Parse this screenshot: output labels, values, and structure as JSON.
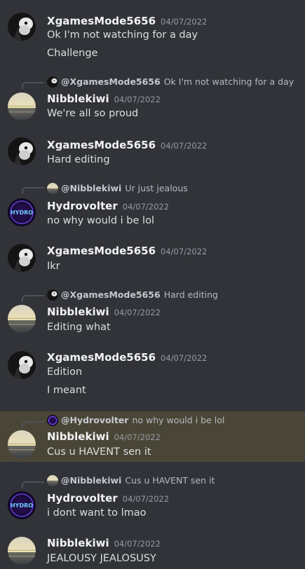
{
  "users": {
    "xgames": "XgamesMode5656",
    "nibble": "Nibblekiwi",
    "hydro": "Hydrovolter"
  },
  "messages": [
    {
      "author": "XgamesMode5656",
      "time": "04/07/2022",
      "lines": [
        "Ok I'm not watching for a day",
        "Challenge"
      ]
    },
    {
      "reply_to": "@XgamesMode5656",
      "reply_text": "Ok I'm not watching for a day",
      "author": "Nibblekiwi",
      "time": "04/07/2022",
      "lines": [
        "We're all so proud"
      ]
    },
    {
      "author": "XgamesMode5656",
      "time": "04/07/2022",
      "lines": [
        "Hard editing"
      ]
    },
    {
      "reply_to": "@Nibblekiwi",
      "reply_text": "Ur just jealous",
      "author": "Hydrovolter",
      "time": "04/07/2022",
      "lines": [
        "no why would i be lol"
      ]
    },
    {
      "author": "XgamesMode5656",
      "time": "04/07/2022",
      "lines": [
        "Ikr"
      ]
    },
    {
      "reply_to": "@XgamesMode5656",
      "reply_text": "Hard editing",
      "author": "Nibblekiwi",
      "time": "04/07/2022",
      "lines": [
        "Editing what"
      ]
    },
    {
      "author": "XgamesMode5656",
      "time": "04/07/2022",
      "lines": [
        "Edition",
        "I meant"
      ]
    },
    {
      "reply_to": "@Hydrovolter",
      "reply_text": "no why would i be lol",
      "author": "Nibblekiwi",
      "time": "04/07/2022",
      "lines": [
        "Cus u HAVENT sen it"
      ],
      "highlighted": true
    },
    {
      "reply_to": "@Nibblekiwi",
      "reply_text": "Cus u HAVENT sen it",
      "author": "Hydrovolter",
      "time": "04/07/2022",
      "lines": [
        "i dont want to lmao"
      ]
    },
    {
      "author": "Nibblekiwi",
      "time": "04/07/2022",
      "lines": [
        "JEALOUSY JEALOSUSY"
      ]
    }
  ],
  "colors": {
    "background": "#313338",
    "highlight": "#4a4637",
    "username": "#f2f3f5",
    "timestamp": "#949ba4",
    "text": "#dbdee1"
  },
  "avatar_hydro_text": "HYDRO"
}
